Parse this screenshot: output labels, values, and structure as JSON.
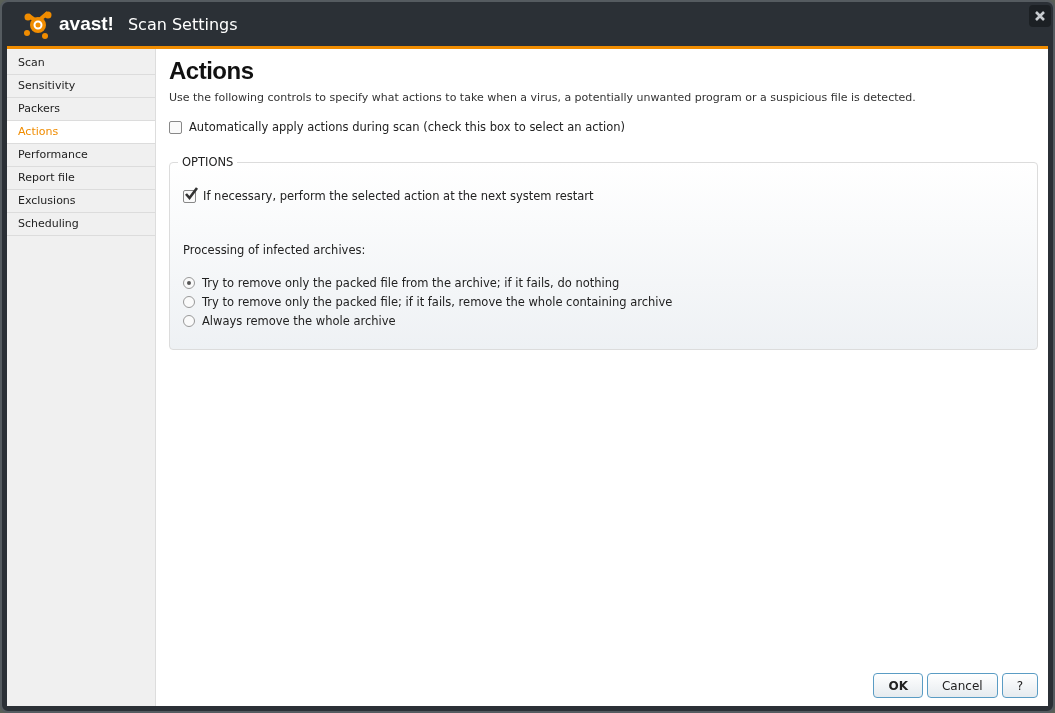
{
  "window": {
    "logo_text": "avast!",
    "title": "Scan Settings"
  },
  "sidebar": {
    "items": [
      {
        "label": "Scan",
        "selected": false
      },
      {
        "label": "Sensitivity",
        "selected": false
      },
      {
        "label": "Packers",
        "selected": false
      },
      {
        "label": "Actions",
        "selected": true
      },
      {
        "label": "Performance",
        "selected": false
      },
      {
        "label": "Report file",
        "selected": false
      },
      {
        "label": "Exclusions",
        "selected": false
      },
      {
        "label": "Scheduling",
        "selected": false
      }
    ]
  },
  "content": {
    "heading": "Actions",
    "description": "Use the following controls to specify what actions to take when a virus, a potentially unwanted program or a suspicious file is detected.",
    "auto_apply": {
      "label": "Automatically apply actions during scan (check this box to select an action)",
      "checked": false
    },
    "options": {
      "legend": "OPTIONS",
      "restart": {
        "label": "If necessary, perform the selected action at the next system restart",
        "checked": true
      },
      "archives_label": "Processing of infected archives:",
      "archive_choices": [
        {
          "label": "Try to remove only the packed file from the archive; if it fails, do nothing",
          "selected": true
        },
        {
          "label": "Try to remove only the packed file; if it fails, remove the whole containing archive",
          "selected": false
        },
        {
          "label": "Always remove the whole archive",
          "selected": false
        }
      ]
    }
  },
  "buttons": [
    {
      "label": "OK",
      "kind": "default"
    },
    {
      "label": "Cancel",
      "kind": "normal"
    },
    {
      "label": "?",
      "kind": "normal"
    }
  ]
}
